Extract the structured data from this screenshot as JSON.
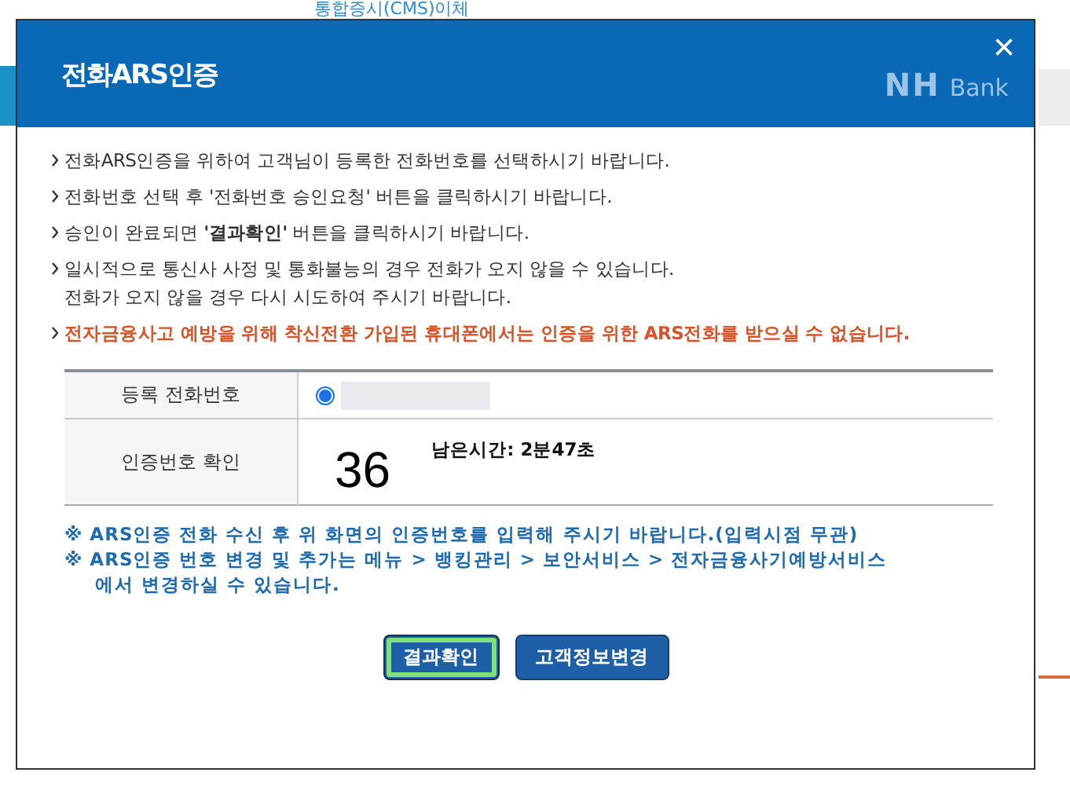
{
  "background": {
    "title": "통합증시(CMS)이체"
  },
  "dialog": {
    "title": "전화ARS인증",
    "logo_mark": "NH",
    "logo_text": "Bank",
    "close": "×",
    "notices": [
      {
        "kind": "normal",
        "text": "전화ARS인증을 위하여 고객님이 등록한 전화번호를 선택하시기 바랍니다."
      },
      {
        "kind": "normal",
        "text": "전화번호 선택 후 '전화번호 승인요청' 버튼을 클릭하시기 바랍니다."
      },
      {
        "kind": "normal",
        "text": "승인이 완료되면 **'결과확인'** 버튼을 클릭하시기 바랍니다."
      },
      {
        "kind": "normal",
        "text": "일시적으로 통신사 사정 및 통화불능의 경우 전화가 오지 않을 수 있습니다.\n전화가 오지 않을 경우 다시 시도하여 주시기 바랍니다."
      },
      {
        "kind": "warning",
        "text": "전자금융사고 예방을 위해 착신전환 가입된 휴대폰에서는 인증을 위한 ARS전화를 받으실 수 없습니다."
      }
    ],
    "table": {
      "rows": [
        {
          "label": "등록 전화번호",
          "radio": {
            "selected": true
          }
        },
        {
          "label": "인증번호 확인",
          "code": "36",
          "timer": "남은시간: 2분47초"
        }
      ]
    },
    "notes": [
      "※ ARS인증 전화 수신 후 위 화면의 인증번호를 입력해 주시기 바랍니다.(입력시점 무관)",
      "※ ARS인증 번호 변경 및 추가는 메뉴 > 뱅킹관리 > 보안서비스 > 전자금융사기예방서비스\n에서 변경하실 수 있습니다."
    ],
    "buttons": [
      {
        "label": "결과확인",
        "focused": true
      },
      {
        "label": "고객정보변경",
        "focused": false
      }
    ]
  }
}
